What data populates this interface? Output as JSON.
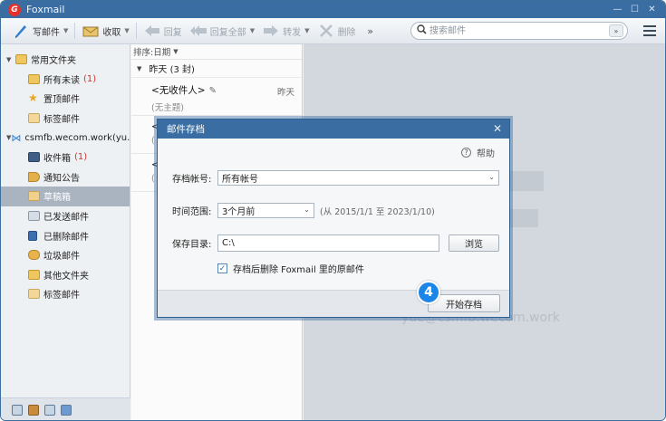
{
  "app": {
    "title": "Foxmail",
    "logo_letter": "G"
  },
  "window_controls": {
    "min": "—",
    "max": "☐",
    "close": "✕"
  },
  "toolbar": {
    "compose": "写邮件",
    "receive": "收取",
    "reply": "回复",
    "reply_all": "回复全部",
    "forward": "转发",
    "delete": "删除",
    "more": "»",
    "search_placeholder": "搜索邮件",
    "search_drop": "»"
  },
  "sidebar": {
    "groups": [
      {
        "label": "常用文件夹",
        "items": [
          {
            "label": "所有未读",
            "count": "(1)"
          },
          {
            "label": "置顶邮件",
            "count": ""
          },
          {
            "label": "标签邮件",
            "count": ""
          }
        ]
      },
      {
        "label": "csmfb.wecom.work(yu...",
        "items": [
          {
            "label": "收件箱",
            "count": "(1)"
          },
          {
            "label": "通知公告",
            "count": ""
          },
          {
            "label": "草稿箱",
            "count": ""
          },
          {
            "label": "已发送邮件",
            "count": ""
          },
          {
            "label": "已删除邮件",
            "count": ""
          },
          {
            "label": "垃圾邮件",
            "count": ""
          },
          {
            "label": "其他文件夹",
            "count": ""
          },
          {
            "label": "标签邮件",
            "count": ""
          }
        ]
      }
    ]
  },
  "maillist": {
    "sort_label": "排序:日期",
    "group_label": "昨天 (3 封)",
    "mails": [
      {
        "from": "<无收件人>",
        "subject": "(无主题)",
        "time": "昨天"
      },
      {
        "from": "<",
        "subject": "(",
        "time": ""
      },
      {
        "from": "<",
        "subject": "(",
        "time": ""
      }
    ]
  },
  "reading": {
    "account_watermark": "yue@csmfb.wecom.work"
  },
  "dialog": {
    "title": "邮件存档",
    "close": "✕",
    "help": "帮助",
    "account_label": "存档帐号:",
    "account_value": "所有帐号",
    "range_label": "时间范围:",
    "range_value": "3个月前",
    "range_hint": "(从 2015/1/1 至 2023/1/10)",
    "dir_label": "保存目录:",
    "dir_value": "C:\\",
    "browse": "浏览",
    "delete_after_label": "存档后删除 Foxmail 里的原邮件",
    "start": "开始存档"
  },
  "step_badge": "4"
}
